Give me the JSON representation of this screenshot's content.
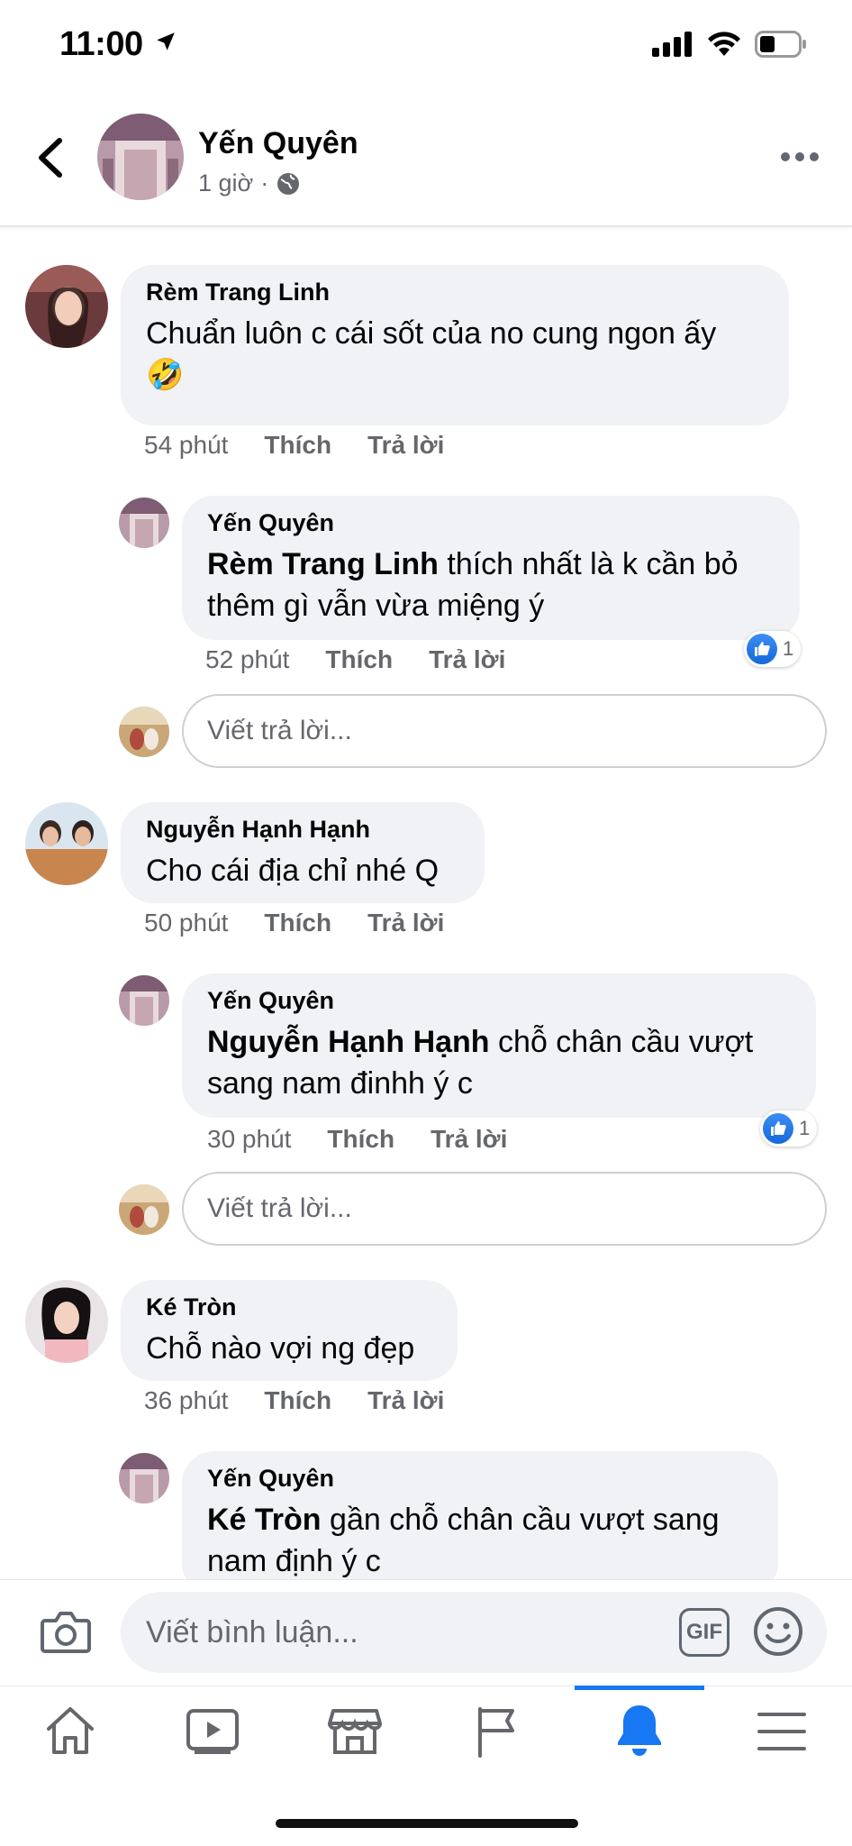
{
  "status_bar": {
    "time": "11:00"
  },
  "post": {
    "author": "Yến Quyên",
    "time": "1 giờ",
    "separator": "·"
  },
  "comments": [
    {
      "author": "Rèm Trang Linh",
      "text": "Chuẩn luôn c cái sốt của no cung ngon ấy",
      "emoji": "🤣",
      "time": "54 phút",
      "like_label": "Thích",
      "reply_label": "Trả lời",
      "reply": {
        "author": "Yến Quyên",
        "mention": "Rèm Trang Linh",
        "text_line1": "thích nhất là k cần bỏ",
        "text_line2": "thêm gì vẫn vừa miệng ý",
        "time": "52 phút",
        "like_label": "Thích",
        "reply_label": "Trả lời",
        "reaction_count": "1"
      }
    },
    {
      "author": "Nguyễn Hạnh Hạnh",
      "text": "Cho cái địa chỉ nhé Q",
      "time": "50 phút",
      "like_label": "Thích",
      "reply_label": "Trả lời",
      "reply": {
        "author": "Yến Quyên",
        "mention": "Nguyễn Hạnh Hạnh",
        "text_line1": "chỗ chân cầu vượt",
        "text_line2": "sang nam đinhh ý c",
        "time": "30 phút",
        "like_label": "Thích",
        "reply_label": "Trả lời",
        "reaction_count": "1"
      }
    },
    {
      "author": "Ké Tròn",
      "text": "Chỗ nào vợi ng đẹp",
      "time": "36 phút",
      "like_label": "Thích",
      "reply_label": "Trả lời",
      "reply": {
        "author": "Yến Quyên",
        "mention": "Ké Tròn",
        "text_line1": "gần chỗ chân cầu vượt sang",
        "text_line2": "nam định ý c"
      }
    }
  ],
  "reply_input": {
    "placeholder": "Viết trả lời..."
  },
  "composer": {
    "placeholder": "Viết bình luận...",
    "gif_label": "GIF"
  },
  "tabbar": {
    "items": [
      "home-icon",
      "watch-icon",
      "marketplace-icon",
      "pages-flag-icon",
      "notifications-bell-icon",
      "menu-icon"
    ],
    "active": "notifications-bell-icon",
    "accent": "#1877f2"
  }
}
